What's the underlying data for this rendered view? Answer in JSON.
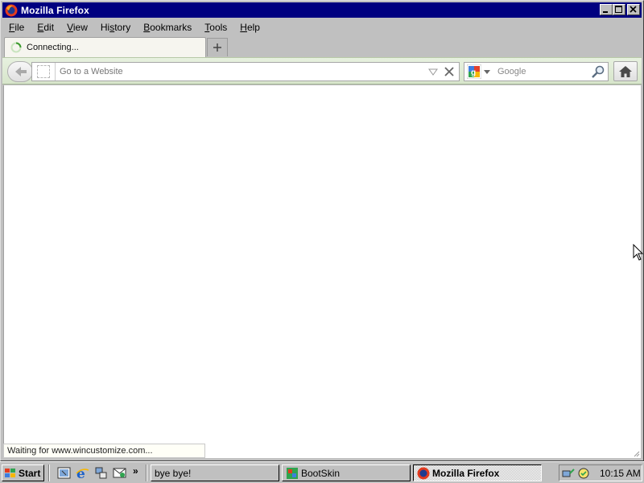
{
  "window": {
    "title": "Mozilla Firefox"
  },
  "menubar": {
    "items": [
      {
        "accel": "F",
        "rest": "ile"
      },
      {
        "accel": "E",
        "rest": "dit"
      },
      {
        "accel": "V",
        "rest": "iew"
      },
      {
        "accel": "",
        "rest": "Hi",
        "accel2": "s",
        "rest2": "tory"
      },
      {
        "accel": "B",
        "rest": "ookmarks"
      },
      {
        "accel": "T",
        "rest": "ools"
      },
      {
        "accel": "H",
        "rest": "elp"
      }
    ]
  },
  "tab": {
    "label": "Connecting..."
  },
  "nav": {
    "url_placeholder": "Go to a Website",
    "search_placeholder": "Google"
  },
  "status": {
    "text": "Waiting for www.wincustomize.com..."
  },
  "taskbar": {
    "start_label": "Start",
    "overflow": "»",
    "tasks": [
      {
        "label": "bye bye!"
      },
      {
        "label": "BootSkin"
      },
      {
        "label": "Mozilla Firefox"
      }
    ],
    "clock": "10:15 AM"
  },
  "colors": {
    "titlebar": "#000080",
    "navbar": "#dbe8cf",
    "desktop": "#008080"
  },
  "icons": [
    "firefox-icon",
    "minimize-icon",
    "maximize-icon",
    "close-icon",
    "loading-spinner-icon",
    "new-tab-icon",
    "back-arrow-icon",
    "site-identity-icon",
    "dropmarker-icon",
    "stop-icon",
    "google-icon",
    "search-icon",
    "home-icon",
    "windows-logo-icon",
    "show-desktop-icon",
    "ie-icon",
    "network-icon",
    "outlook-icon",
    "bootskin-icon",
    "tray-icon",
    "mouse-cursor-icon"
  ]
}
